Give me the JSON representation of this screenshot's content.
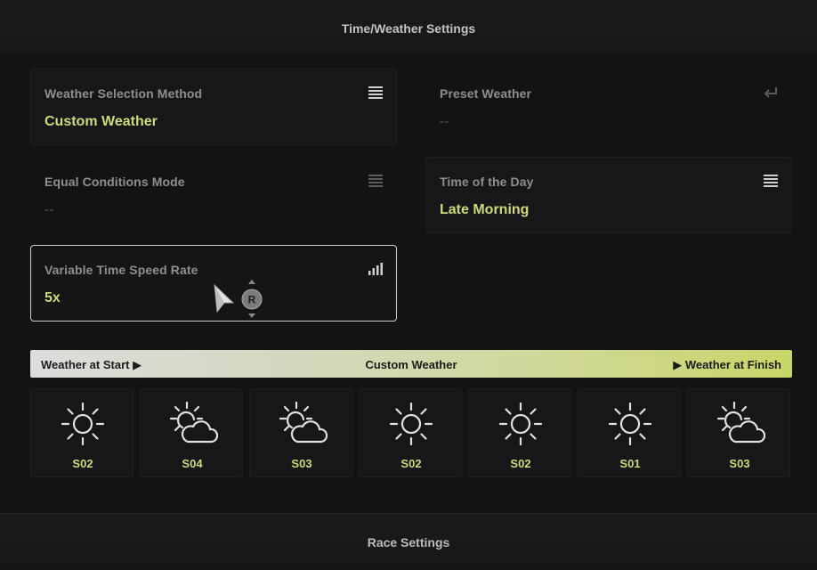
{
  "header": {
    "title": "Time/Weather Settings"
  },
  "settings": {
    "weather_method": {
      "label": "Weather Selection Method",
      "value": "Custom Weather",
      "icon": "list-icon"
    },
    "preset_weather": {
      "label": "Preset Weather",
      "value": "--",
      "icon": "return-icon"
    },
    "equal_conditions": {
      "label": "Equal Conditions Mode",
      "value": "--",
      "icon": "list-icon"
    },
    "time_of_day": {
      "label": "Time of the Day",
      "value": "Late Morning",
      "icon": "list-icon"
    },
    "time_speed": {
      "label": "Variable Time Speed Rate",
      "value": "5x",
      "icon": "signal-bars-icon"
    }
  },
  "controller_hint": {
    "button": "R"
  },
  "weather_band": {
    "start": "Weather at Start ▶",
    "title": "Custom Weather",
    "finish": "▶ Weather at Finish"
  },
  "weather_slots": [
    {
      "code": "S02",
      "icon": "sun-icon"
    },
    {
      "code": "S04",
      "icon": "sun-cloud-icon"
    },
    {
      "code": "S03",
      "icon": "sun-cloud-icon"
    },
    {
      "code": "S02",
      "icon": "sun-icon"
    },
    {
      "code": "S02",
      "icon": "sun-icon"
    },
    {
      "code": "S01",
      "icon": "sun-icon"
    },
    {
      "code": "S03",
      "icon": "sun-cloud-icon"
    }
  ],
  "footer": {
    "title": "Race Settings"
  },
  "colors": {
    "accent": "#cfd97a",
    "background": "#121314",
    "label": "#8e8f90"
  }
}
